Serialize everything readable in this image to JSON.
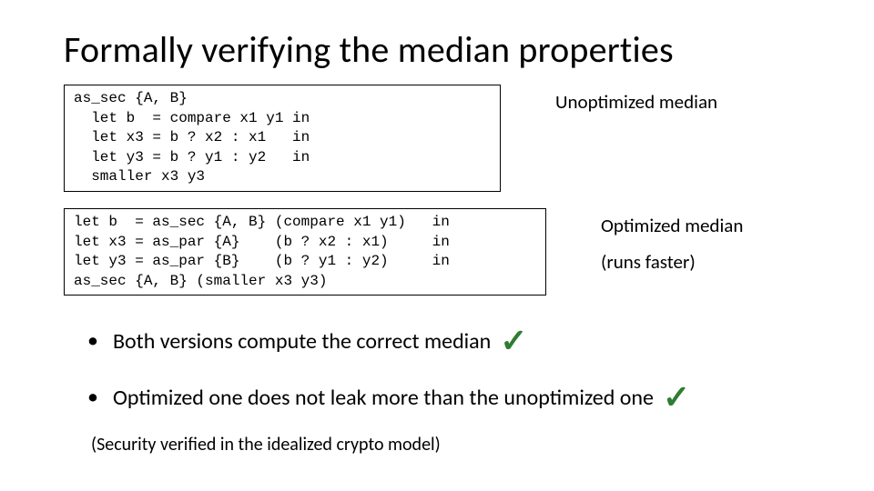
{
  "title": "Formally verifying the median properties",
  "code1": "as_sec {A, B}\n  let b  = compare x1 y1 in\n  let x3 = b ? x2 : x1   in\n  let y3 = b ? y1 : y2   in\n  smaller x3 y3",
  "label1": "Unoptimized median",
  "code2": "let b  = as_sec {A, B} (compare x1 y1)   in\nlet x3 = as_par {A}    (b ? x2 : x1)     in\nlet y3 = as_par {B}    (b ? y1 : y2)     in\nas_sec {A, B} (smaller x3 y3)",
  "label2a": "Optimized median",
  "label2b": "(runs faster)",
  "bullet1": "Both versions compute the correct median",
  "bullet2": "Optimized one does not leak more than the unoptimized one",
  "note": "(Security verified in the idealized crypto model)",
  "check": "✓",
  "dot": "•"
}
